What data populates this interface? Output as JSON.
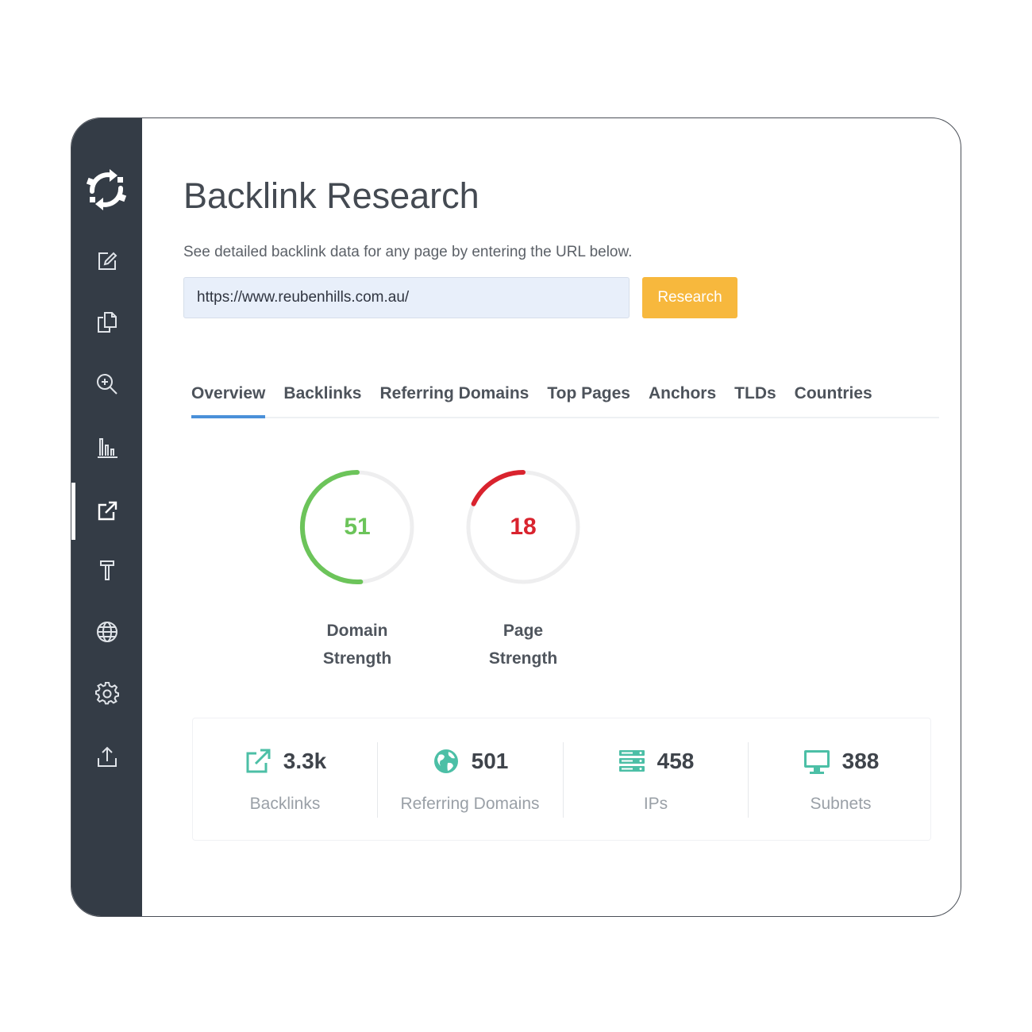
{
  "page": {
    "title": "Backlink Research",
    "subtitle": "See detailed backlink data for any page by entering the URL below."
  },
  "search": {
    "url_value": "https://www.reubenhills.com.au/",
    "button_label": "Research",
    "button_color": "#f7b83d"
  },
  "sidebar": {
    "items": [
      {
        "icon": "edit-icon"
      },
      {
        "icon": "copy-icon"
      },
      {
        "icon": "search-zoom-icon"
      },
      {
        "icon": "bar-chart-icon"
      },
      {
        "icon": "external-link-icon",
        "active": true
      },
      {
        "icon": "hammer-icon"
      },
      {
        "icon": "globe-icon"
      },
      {
        "icon": "gear-icon"
      },
      {
        "icon": "upload-icon"
      }
    ]
  },
  "tabs": [
    {
      "label": "Overview",
      "active": true
    },
    {
      "label": "Backlinks"
    },
    {
      "label": "Referring Domains"
    },
    {
      "label": "Top Pages"
    },
    {
      "label": "Anchors"
    },
    {
      "label": "TLDs"
    },
    {
      "label": "Countries"
    }
  ],
  "gauges": [
    {
      "value": "51",
      "score": 51,
      "label_line1": "Domain",
      "label_line2": "Strength",
      "color": "#6cc45a"
    },
    {
      "value": "18",
      "score": 18,
      "label_line1": "Page",
      "label_line2": "Strength",
      "color": "#d9232e"
    }
  ],
  "stats": [
    {
      "value": "3.3k",
      "label": "Backlinks",
      "icon": "external-link-icon"
    },
    {
      "value": "501",
      "label": "Referring Domains",
      "icon": "globe-icon"
    },
    {
      "value": "458",
      "label": "IPs",
      "icon": "server-icon"
    },
    {
      "value": "388",
      "label": "Subnets",
      "icon": "monitor-icon"
    }
  ],
  "colors": {
    "sidebar": "#343c46",
    "accent_tab": "#4a90d9",
    "stat_icon": "#4cbfa6"
  }
}
